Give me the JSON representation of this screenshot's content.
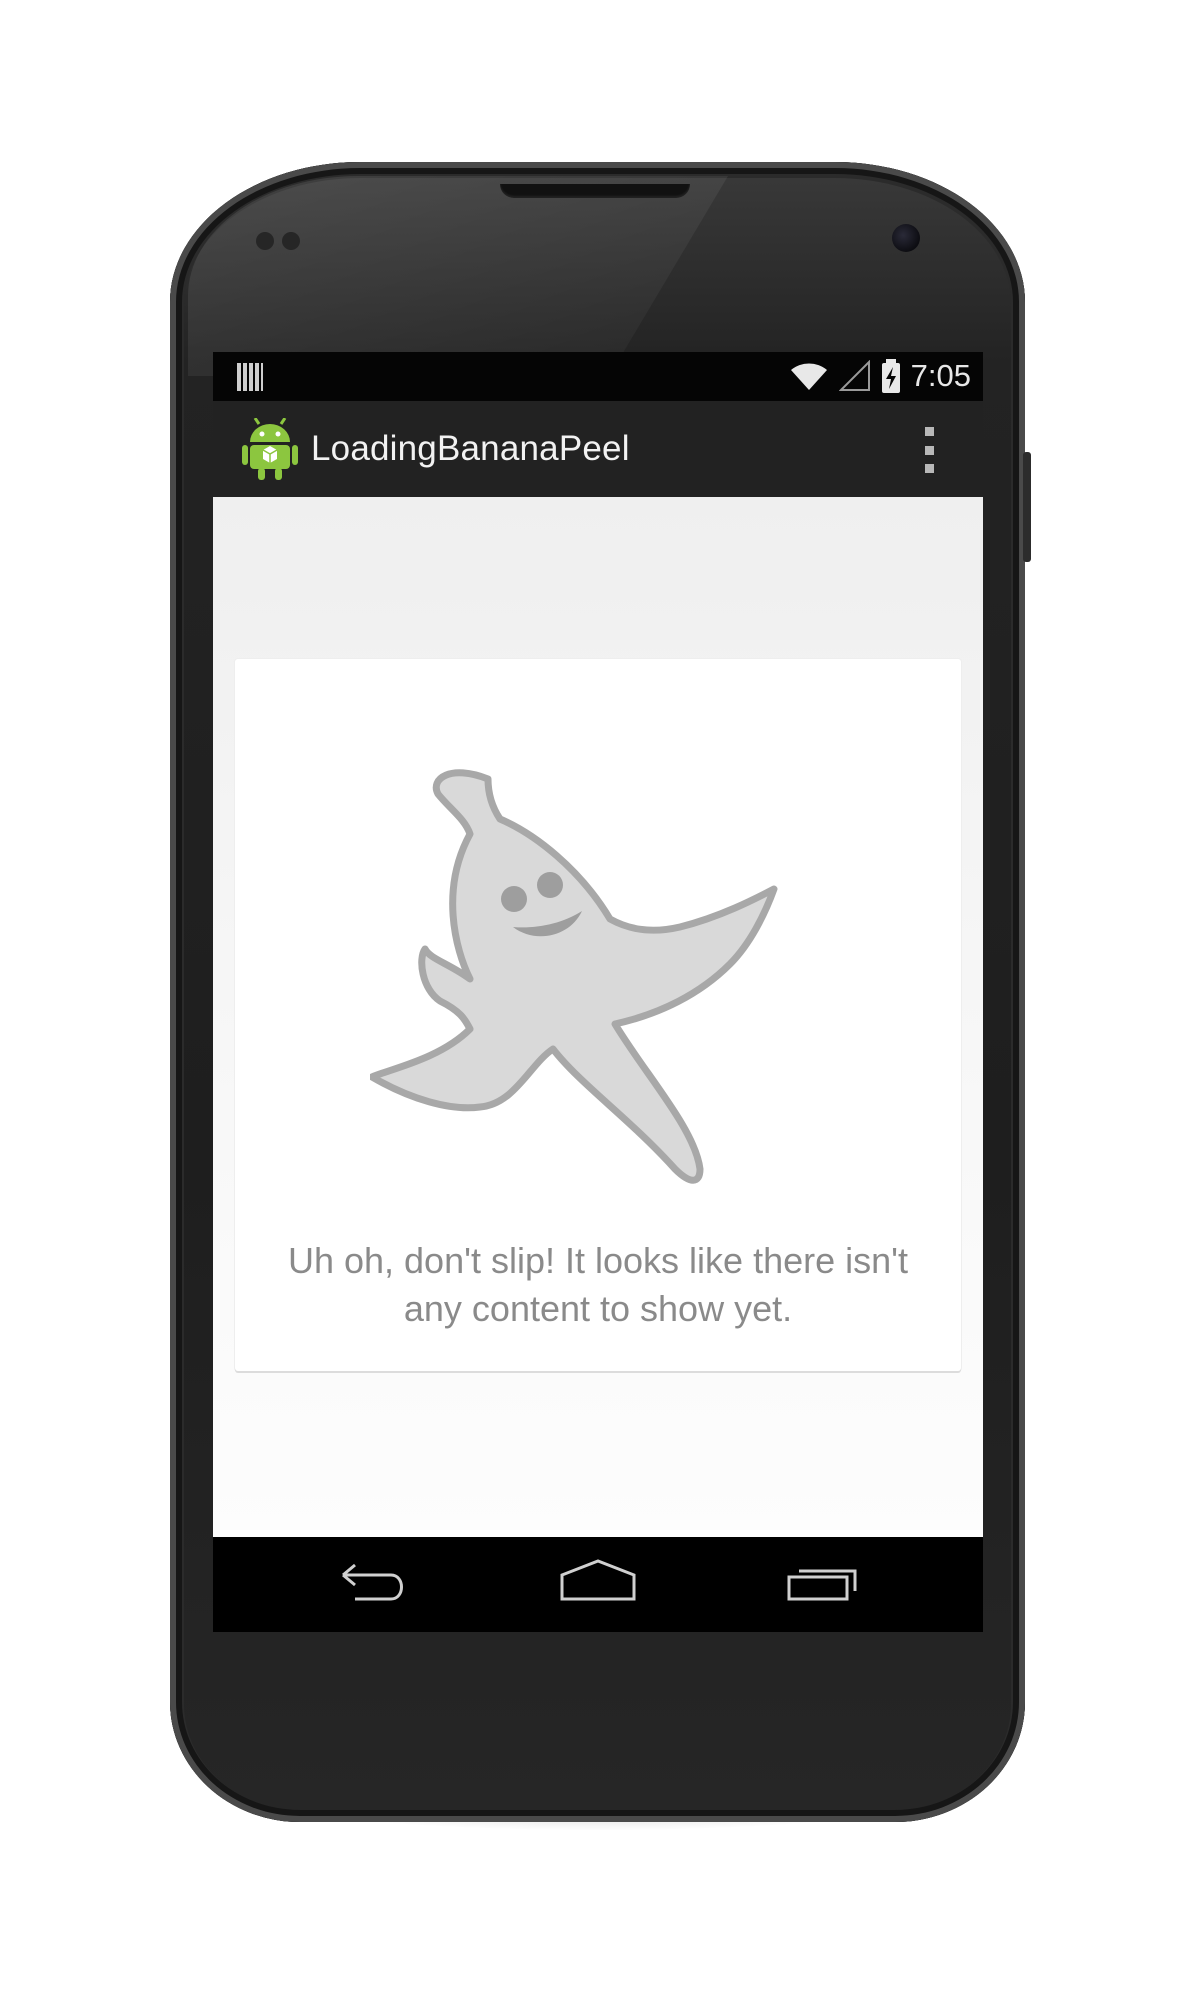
{
  "status_bar": {
    "time": "7:05"
  },
  "action_bar": {
    "title": "LoadingBananaPeel"
  },
  "empty_state": {
    "message": "Uh oh, don't slip! It looks like there isn't any content to show yet."
  },
  "icons": {
    "status_left": "notification-bars-icon",
    "wifi": "wifi-icon",
    "signal": "cell-signal-icon",
    "battery": "battery-charging-icon",
    "app": "android-robot-icon",
    "overflow": "overflow-menu-icon",
    "illustration": "banana-peel-mascot",
    "back": "back-icon",
    "home": "home-icon",
    "recents": "recent-apps-icon"
  },
  "colors": {
    "action_bar": "#222222",
    "status_bar": "#050505",
    "content_background": "#f2f2f2",
    "message_text": "#8a8a8a",
    "android_green": "#8cc63f"
  }
}
